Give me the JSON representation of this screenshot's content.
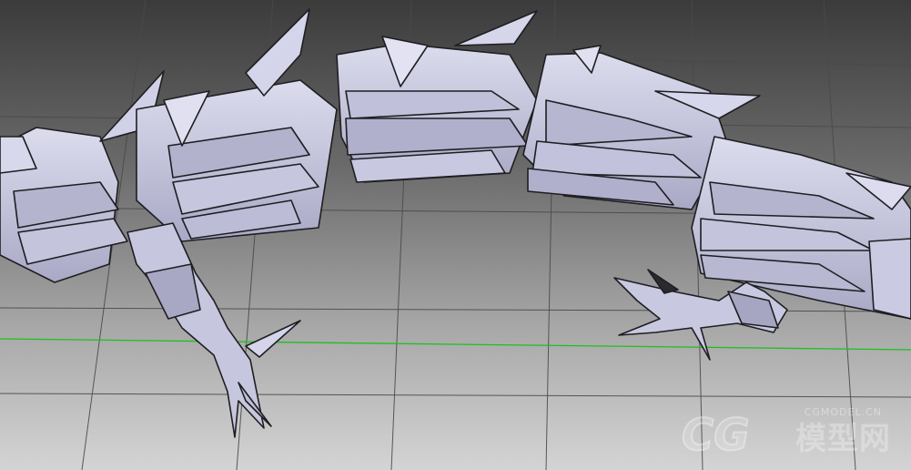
{
  "viewport": {
    "background_top": "#3c3c3c",
    "background_bottom": "#cfcfcf",
    "grid_color": "#4a4a4a",
    "axis_line_color": "#1fbf1f",
    "model_fill": "#c9c9e0",
    "model_shade": "#9a9ab8",
    "model_edge": "#1e1e22"
  },
  "watermark": {
    "domain_text": "CGMODEL.CN",
    "logo_text": "CG",
    "brand_text": "模型网"
  }
}
